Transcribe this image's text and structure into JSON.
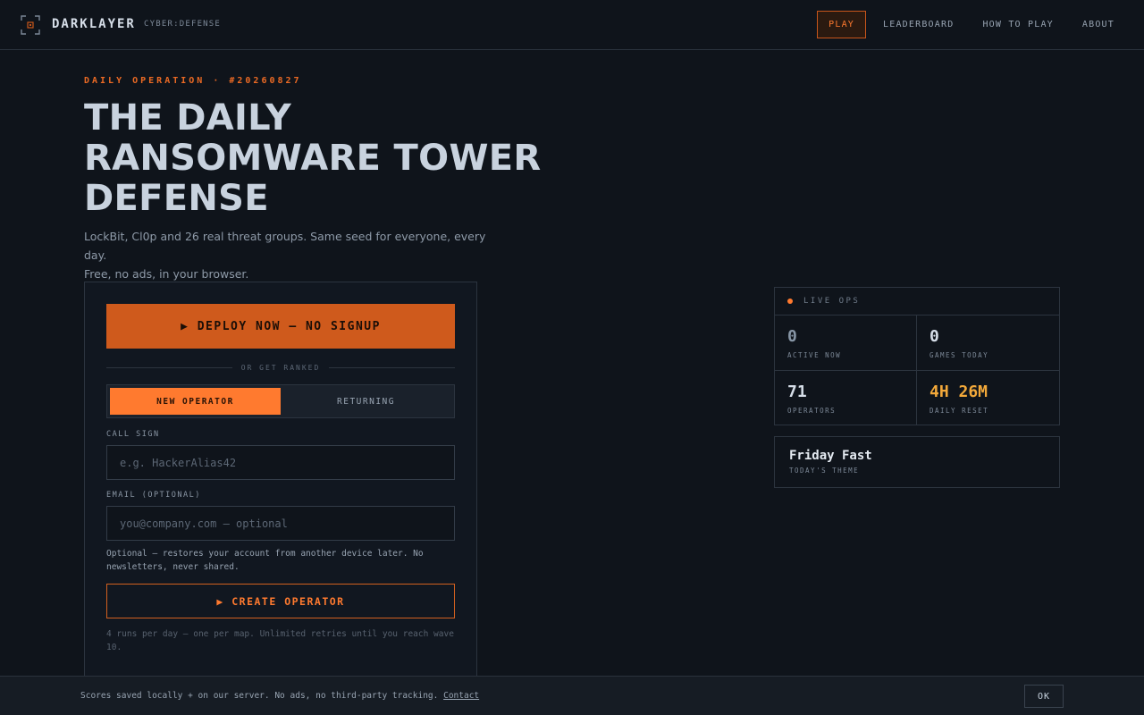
{
  "brand": {
    "name": "DARKLAYER",
    "tagline": "CYBER:DEFENSE",
    "icon": "crosshair-frame-icon"
  },
  "nav": {
    "items": [
      {
        "label": "PLAY",
        "active": true
      },
      {
        "label": "LEADERBOARD",
        "active": false
      },
      {
        "label": "HOW TO PLAY",
        "active": false
      },
      {
        "label": "ABOUT",
        "active": false
      }
    ]
  },
  "hero": {
    "eyebrow": "DAILY OPERATION · #20260827",
    "title_lines": [
      "THE DAILY",
      "RANSOMWARE TOWER",
      "DEFENSE"
    ],
    "subtitle_lines": [
      "LockBit, Cl0p and 26 real threat groups. Same seed for everyone, every day.",
      "Free, no ads, in your browser."
    ]
  },
  "form": {
    "deploy_label": "▶ DEPLOY NOW — NO SIGNUP",
    "divider_text": "OR GET RANKED",
    "tabs": [
      {
        "label": "NEW OPERATOR",
        "selected": true
      },
      {
        "label": "RETURNING",
        "selected": false
      }
    ],
    "callsign": {
      "label": "CALL SIGN",
      "placeholder": "e.g. HackerAlias42",
      "value": ""
    },
    "email": {
      "label": "EMAIL (OPTIONAL)",
      "placeholder": "you@company.com — optional",
      "value": ""
    },
    "email_note": "Optional — restores your account from another device later. No newsletters, never shared.",
    "create_label": "▶ CREATE OPERATOR",
    "footnote": "4 runs per day — one per map. Unlimited retries until you reach wave 10."
  },
  "live_ops": {
    "title": "LIVE OPS",
    "stats": [
      {
        "value": "0",
        "label": "ACTIVE NOW"
      },
      {
        "value": "0",
        "label": "GAMES TODAY"
      },
      {
        "value": "71",
        "label": "OPERATORS"
      },
      {
        "value": "4H 26M",
        "label": "DAILY RESET"
      }
    ]
  },
  "theme": {
    "name": "Friday Fast",
    "label": "TODAY'S THEME"
  },
  "cookie": {
    "text": "Scores saved locally + on our server. No ads, no third-party tracking.",
    "link": "Contact",
    "ok": "OK"
  },
  "colors": {
    "accent": "#ff7a2f",
    "accent_dark": "#cf5a1c",
    "gold": "#f3a93a",
    "bg": "#0f141b"
  }
}
